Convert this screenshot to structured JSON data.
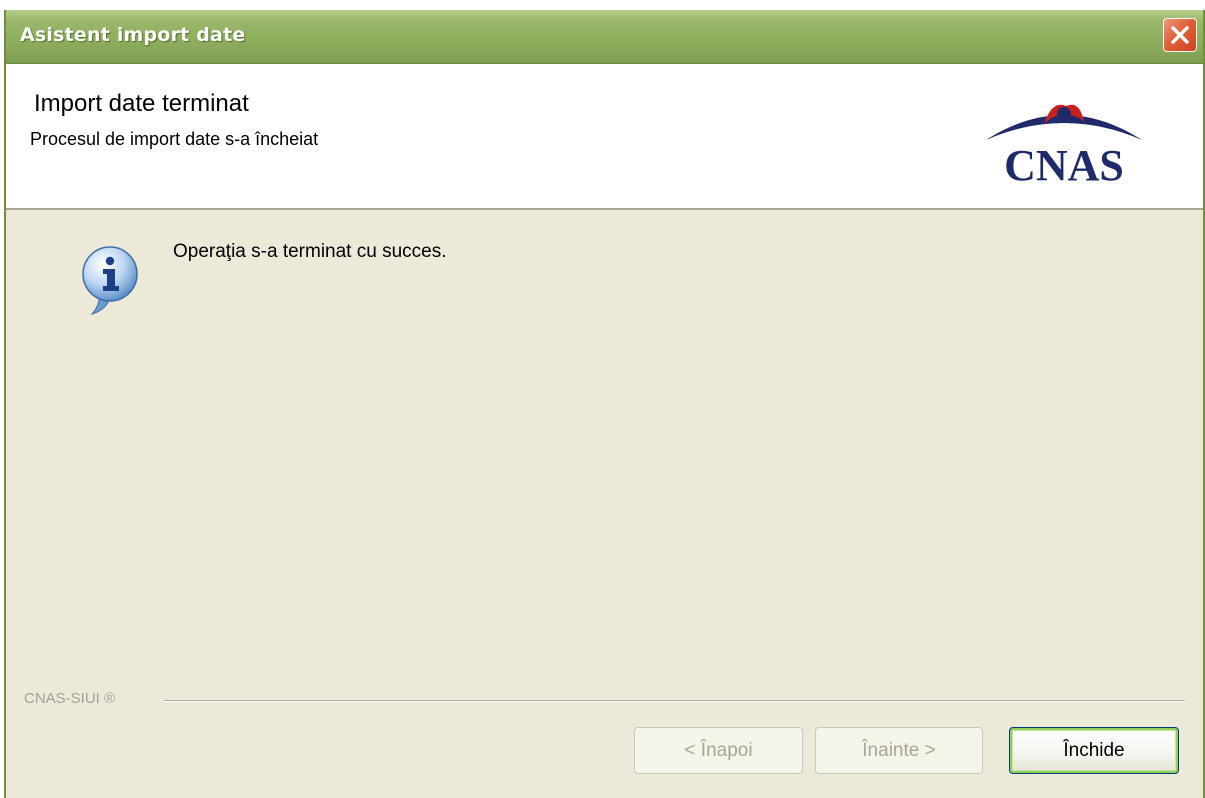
{
  "window": {
    "title": "Asistent import date"
  },
  "header": {
    "title": "Import date terminat",
    "subtitle": "Procesul de import date s-a încheiat",
    "logo_text": "CNAS"
  },
  "main": {
    "message": "Operaţia s-a terminat cu succes."
  },
  "footer": {
    "brand_label": "CNAS-SIUI ®"
  },
  "buttons": {
    "back_label": "< Înapoi",
    "next_label": "Înainte >",
    "close_label": "Închide"
  },
  "icons": {
    "close": "close-icon",
    "info": "info-icon",
    "logo": "cnas-logo"
  },
  "colors": {
    "titlebar": "#8fae5e",
    "dialog_bg": "#ece9d8",
    "logo_blue": "#1f2a6b",
    "logo_red": "#c8201e",
    "close_red": "#e0603a"
  }
}
